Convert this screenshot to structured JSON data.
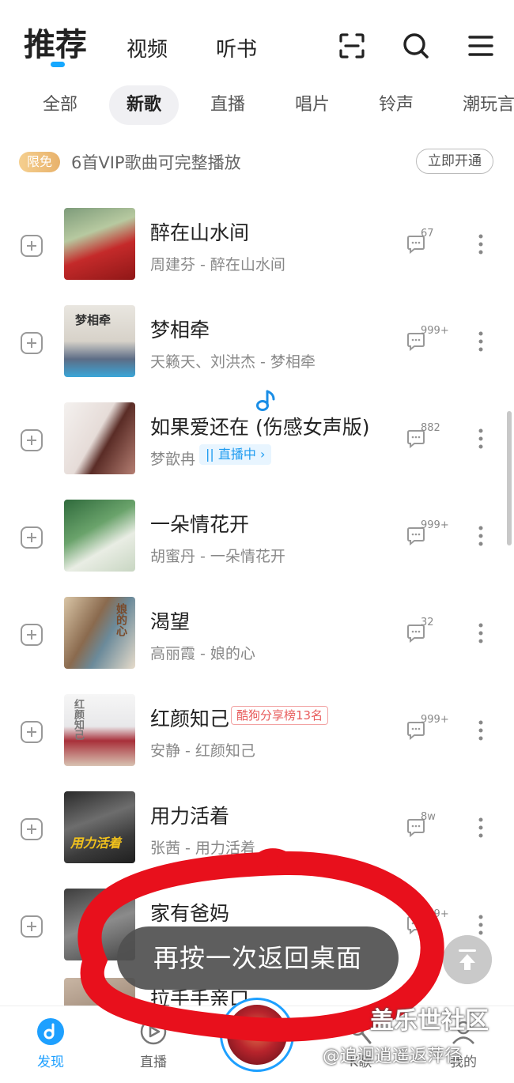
{
  "header": {
    "tabs": [
      {
        "label": "推荐"
      },
      {
        "label": "视频"
      },
      {
        "label": "听书"
      }
    ],
    "icons": [
      "scan-icon",
      "search-icon",
      "menu-icon"
    ],
    "accent": "#16a8ff"
  },
  "chips": [
    "全部",
    "新歌",
    "直播",
    "唱片",
    "铃声",
    "潮玩言"
  ],
  "vip_bar": {
    "badge": "限免",
    "text": "6首VIP歌曲可完整播放",
    "button": "立即开通"
  },
  "songs": [
    {
      "title": "醉在山水间",
      "subtitle": "周建芬 - 醉在山水间",
      "comments": "67"
    },
    {
      "title": "梦相牵",
      "subtitle": "天籁天、刘洪杰 - 梦相牵",
      "comments": "999+",
      "cover_text": "梦相牵"
    },
    {
      "title": "如果爱还在 (伤感女声版)",
      "subtitle": "梦歆冉",
      "live_tag": "直播中",
      "comments": "882"
    },
    {
      "title": "一朵情花开",
      "subtitle": "胡蜜丹 - 一朵情花开",
      "comments": "999+"
    },
    {
      "title": "渴望",
      "subtitle": "高丽霞 - 娘的心",
      "comments": "32",
      "cover_text": "娘的心"
    },
    {
      "title": "红颜知己",
      "subtitle": "安静 - 红颜知己",
      "rank_tag": "酷狗分享榜13名",
      "comments": "999+",
      "cover_text": "红颜知己"
    },
    {
      "title": "用力活着",
      "subtitle": "张茜 - 用力活着",
      "comments": "8w",
      "cover_text": "用力活着"
    },
    {
      "title": "家有爸妈",
      "subtitle": "",
      "comments": "999+"
    },
    {
      "title": "拉手手亲口",
      "subtitle": "",
      "comments": ""
    }
  ],
  "toast": "再按一次返回桌面",
  "bottom_nav": [
    {
      "label": "发现",
      "icon": "discover-icon",
      "active": true
    },
    {
      "label": "直播",
      "icon": "live-play-icon",
      "active": false
    },
    {
      "label": "K歌",
      "icon": "karaoke-icon",
      "active": false
    },
    {
      "label": "我的",
      "icon": "profile-icon",
      "active": false
    }
  ],
  "watermark": {
    "site": "盖乐世社区",
    "user": "@追迴逍遥返萍径"
  }
}
